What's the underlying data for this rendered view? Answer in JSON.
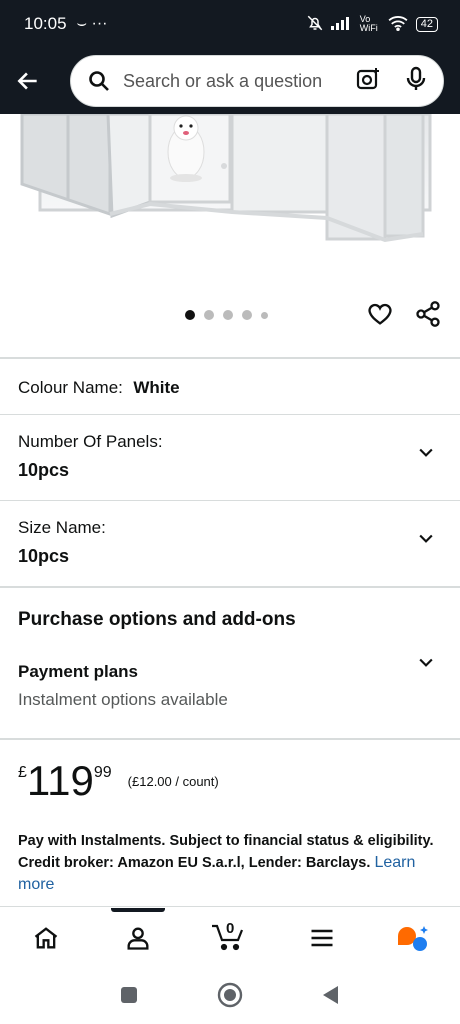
{
  "status_bar": {
    "time": "10:05",
    "extra": "⌣ ···",
    "network": "Vo WiFi",
    "battery": "42"
  },
  "search": {
    "placeholder": "Search or ask a question"
  },
  "carousel": {
    "total_dots": 5,
    "active_index": 0
  },
  "variations": {
    "colour_label": "Colour Name:",
    "colour_value": "White",
    "panels_label": "Number Of Panels:",
    "panels_value": "10pcs",
    "size_label": "Size Name:",
    "size_value": "10pcs"
  },
  "purchase": {
    "title": "Purchase options and add-ons",
    "payment_title": "Payment plans",
    "payment_sub": "Instalment options available"
  },
  "price": {
    "symbol": "£",
    "whole": "119",
    "fraction": "99",
    "unit_price": "(£12.00 / count)"
  },
  "instalments": {
    "text": "Pay with Instalments. Subject to financial status & eligibility. Credit broker: Amazon EU S.a.r.l, Lender: Barclays.",
    "link": "Learn more"
  },
  "bottom_nav": {
    "cart_count": "0"
  },
  "colors": {
    "header_bg": "#131921",
    "link": "#2162a1",
    "rufus_orange": "#ff6a00",
    "rufus_blue": "#1e7ef0"
  }
}
